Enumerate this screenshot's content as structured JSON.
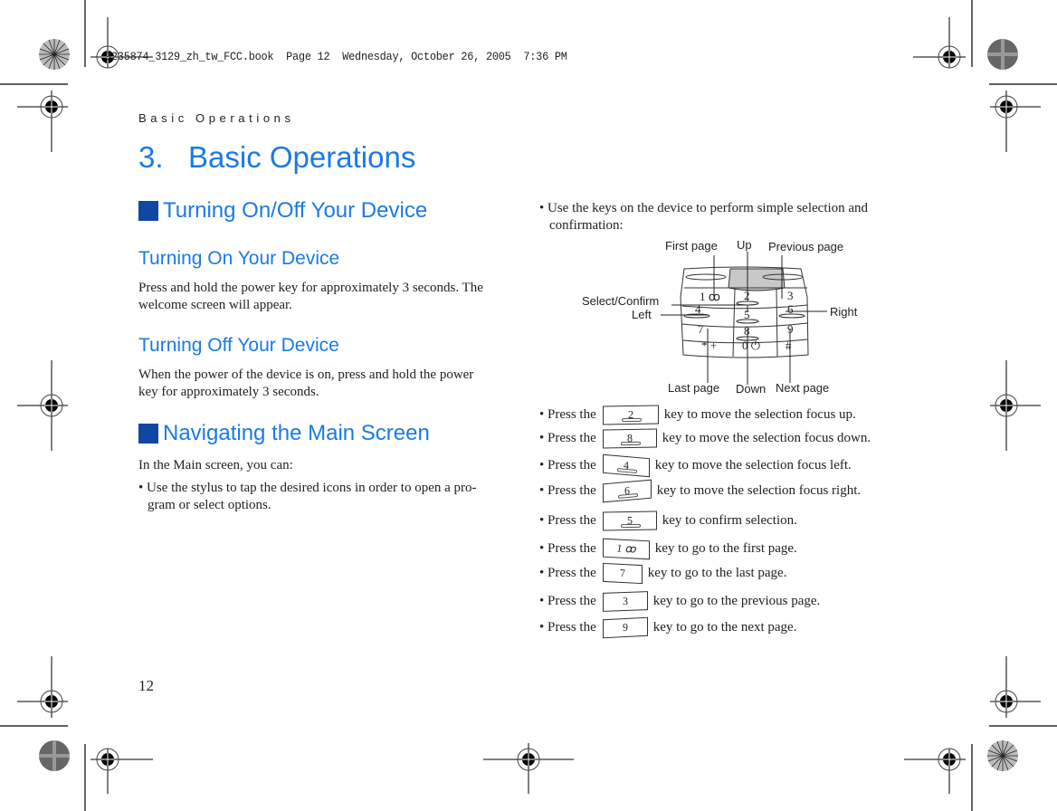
{
  "print_slug": "9235874_3129_zh_tw_FCC.book  Page 12  Wednesday, October 26, 2005  7:36 PM",
  "running_header": "Basic Operations",
  "chapter_title": "3.   Basic Operations",
  "page_number": "12",
  "left_column": {
    "section1_title": "Turning On/Off Your Device",
    "sub1_title": "Turning On Your Device",
    "sub1_text_line1": "Press and hold the power key for approximately 3 seconds. The",
    "sub1_text_line2": "welcome screen will appear.",
    "sub2_title": "Turning Off Your Device",
    "sub2_text_line1": "When the power of the device is on, press and hold the power",
    "sub2_text_line2": "key for approximately 3 seconds.",
    "section2_title": "Navigating the Main Screen",
    "intro": "In the Main screen, you can:",
    "bullet1_line1": "• Use the stylus to tap the desired icons in order to open a pro-",
    "bullet1_line2": "gram or select options."
  },
  "right_column": {
    "bullet_intro_line1": "• Use the keys on the device to perform simple selection and",
    "bullet_intro_line2": "confirmation:",
    "diagram_labels": {
      "first_page": "First page",
      "up": "Up",
      "previous_page": "Previous page",
      "select_confirm": "Select/Confirm",
      "left": "Left",
      "right": "Right",
      "last_page": "Last page",
      "down": "Down",
      "next_page": "Next page"
    },
    "keypad_keys": [
      "1 ꝏ",
      "2",
      "3",
      "4",
      "5",
      "6",
      "7",
      "8",
      "9",
      "* +",
      "0 ⏻",
      "#"
    ],
    "key_instructions": [
      {
        "prefix": "• Press the",
        "key": "2",
        "text": "key to move the selection focus up."
      },
      {
        "prefix": "• Press the",
        "key": "8",
        "text": "key to move the selection focus down."
      },
      {
        "prefix": "• Press the",
        "key": "4",
        "text": "key to move the selection focus left."
      },
      {
        "prefix": "• Press the",
        "key": "6",
        "text": "key to move the selection focus right."
      },
      {
        "prefix": "• Press the",
        "key": "5",
        "text": "key to confirm selection."
      },
      {
        "prefix": "• Press the",
        "key": "1 ꝏ",
        "text": "key to go to the first page."
      },
      {
        "prefix": "• Press the",
        "key": "7",
        "text": "key to go to the last page."
      },
      {
        "prefix": "• Press the",
        "key": "3",
        "text": "key to go to the previous page."
      },
      {
        "prefix": "• Press the",
        "key": "9",
        "text": "key to go to the next page."
      }
    ]
  },
  "colors": {
    "heading_blue": "#1a7ae6",
    "square_blue": "#0f47a5"
  }
}
